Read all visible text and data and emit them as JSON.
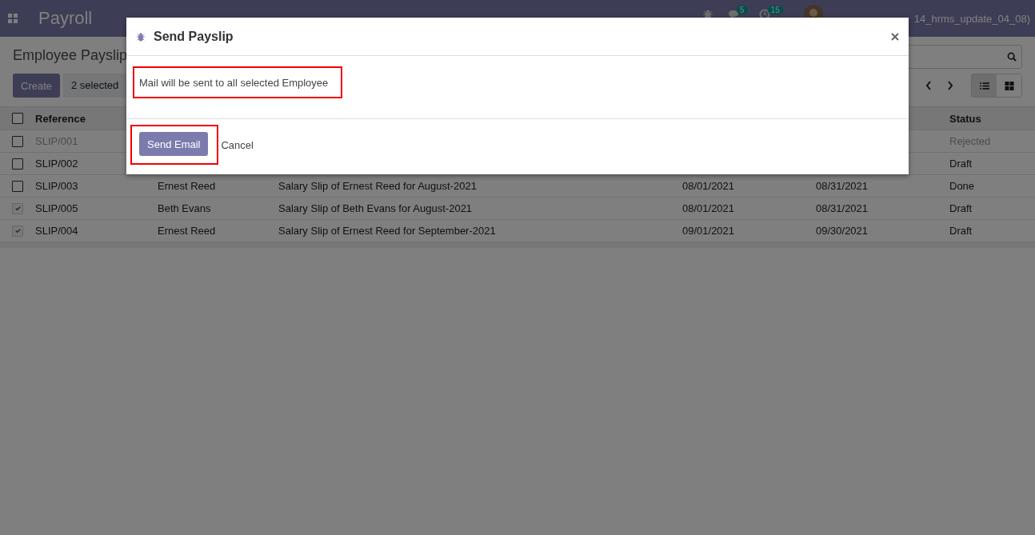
{
  "navbar": {
    "app_name": "Payroll",
    "chat_count": "5",
    "activity_count": "15",
    "user": "14_hrms_update_04_08)"
  },
  "control_panel": {
    "title": "Employee Payslip",
    "create_button": "Create",
    "selection": "2 selected",
    "views": [
      {
        "kind": "list",
        "selected": true
      },
      {
        "kind": "kanban",
        "selected": false
      }
    ]
  },
  "table": {
    "all_checked": false,
    "columns": [
      "Reference",
      null,
      null,
      null,
      null,
      "Status"
    ],
    "rows": [
      {
        "checked": false,
        "muted": true,
        "cells": [
          "SLIP/001",
          null,
          null,
          null,
          null,
          "Rejected"
        ]
      },
      {
        "checked": false,
        "muted": false,
        "cells": [
          "SLIP/002",
          null,
          null,
          null,
          null,
          "Draft"
        ]
      },
      {
        "checked": false,
        "muted": false,
        "cells": [
          "SLIP/003",
          "Ernest Reed",
          "Salary Slip of Ernest Reed for August-2021",
          "08/01/2021",
          "08/31/2021",
          "Done"
        ]
      },
      {
        "checked": true,
        "muted": false,
        "cells": [
          "SLIP/005",
          "Beth Evans",
          "Salary Slip of Beth Evans for August-2021",
          "08/01/2021",
          "08/31/2021",
          "Draft"
        ]
      },
      {
        "checked": true,
        "muted": false,
        "cells": [
          "SLIP/004",
          "Ernest Reed",
          "Salary Slip of Ernest Reed for September-2021",
          "09/01/2021",
          "09/30/2021",
          "Draft"
        ]
      }
    ]
  },
  "dialog": {
    "title": "Send Payslip",
    "message": "Mail will be sent to all selected Employee",
    "message_highlighted": true,
    "send_button": "Send Email",
    "send_highlighted": true,
    "cancel": "Cancel"
  }
}
